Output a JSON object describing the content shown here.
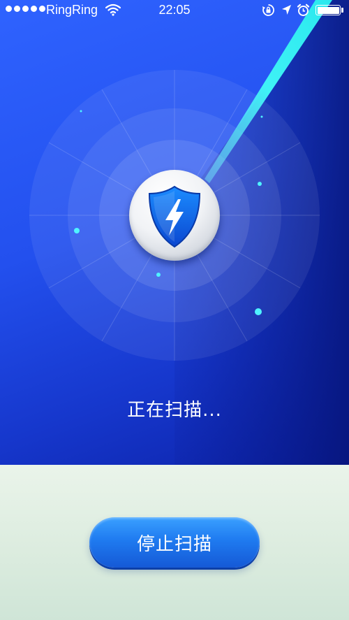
{
  "status_bar": {
    "carrier": "RingRing",
    "time": "22:05",
    "signal_bars": 5,
    "battery_level": 1.0,
    "icons": [
      "wifi-icon",
      "rotation-lock-icon",
      "location-arrow-icon",
      "alarm-clock-icon",
      "battery-icon"
    ]
  },
  "scan": {
    "status_label": "正在扫描...",
    "shield_icon": "shield-lightning-icon"
  },
  "actions": {
    "stop_scan_label": "停止扫描"
  },
  "colors": {
    "primary_blue": "#2350ee",
    "deep_blue": "#0c22a8",
    "scan_beam": "#35f0f5",
    "button_blue": "#1f7bf0",
    "bottom_panel": "#dcecdf"
  }
}
